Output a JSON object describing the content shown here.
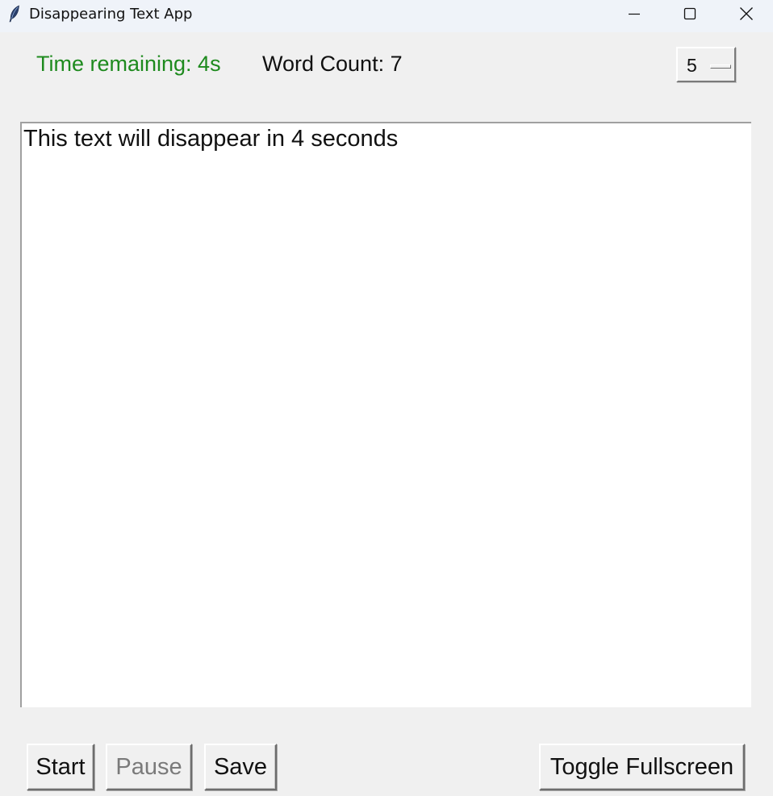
{
  "window": {
    "title": "Disappearing Text App",
    "icon": "feather-icon"
  },
  "status": {
    "timer_label": "Time remaining: 4s",
    "timer_color": "#1e8a1e",
    "word_count_label": "Word Count: 7"
  },
  "duration_select": {
    "selected_value": "5"
  },
  "editor": {
    "text": "This text will disappear in 4 seconds"
  },
  "buttons": {
    "start": "Start",
    "pause": "Pause",
    "save": "Save",
    "fullscreen": "Toggle Fullscreen"
  }
}
